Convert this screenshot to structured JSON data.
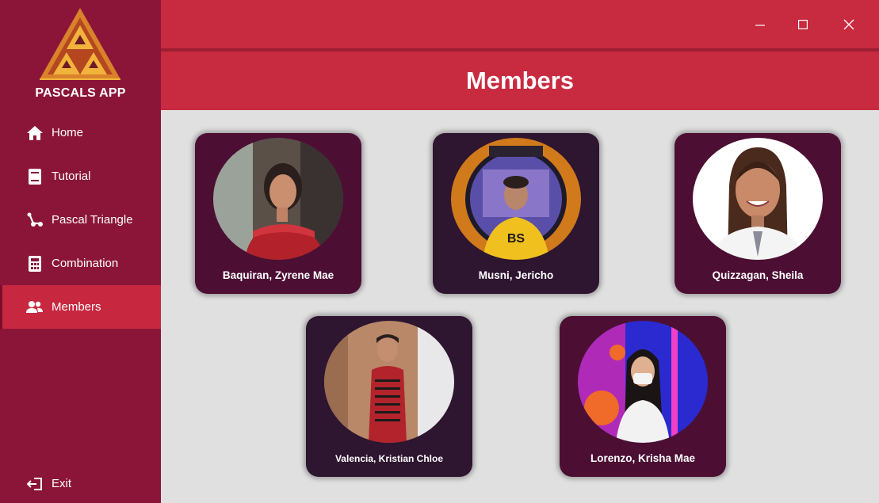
{
  "app": {
    "logo_text": "PASCALS APP"
  },
  "sidebar": {
    "items": [
      {
        "label": "Home",
        "icon": "home-icon"
      },
      {
        "label": "Tutorial",
        "icon": "book-icon"
      },
      {
        "label": "Pascal Triangle",
        "icon": "triangle-icon"
      },
      {
        "label": "Combination",
        "icon": "calculator-icon"
      },
      {
        "label": "Members",
        "icon": "users-icon",
        "active": true
      }
    ],
    "exit_label": "Exit"
  },
  "window": {
    "controls": [
      "minimize",
      "maximize",
      "close"
    ]
  },
  "page": {
    "title": "Members"
  },
  "members": [
    {
      "name": "Baquiran, Zyrene Mae"
    },
    {
      "name": "Musni, Jericho"
    },
    {
      "name": "Quizzagan, Sheila"
    },
    {
      "name": "Valencia, Kristian Chloe"
    },
    {
      "name": "Lorenzo, Krisha Mae"
    }
  ],
  "colors": {
    "sidebar": "#8b1538",
    "accent": "#c82a40",
    "card": "#4c0f33",
    "card_dark": "#2e1530",
    "content_bg": "#e0e0e0"
  }
}
